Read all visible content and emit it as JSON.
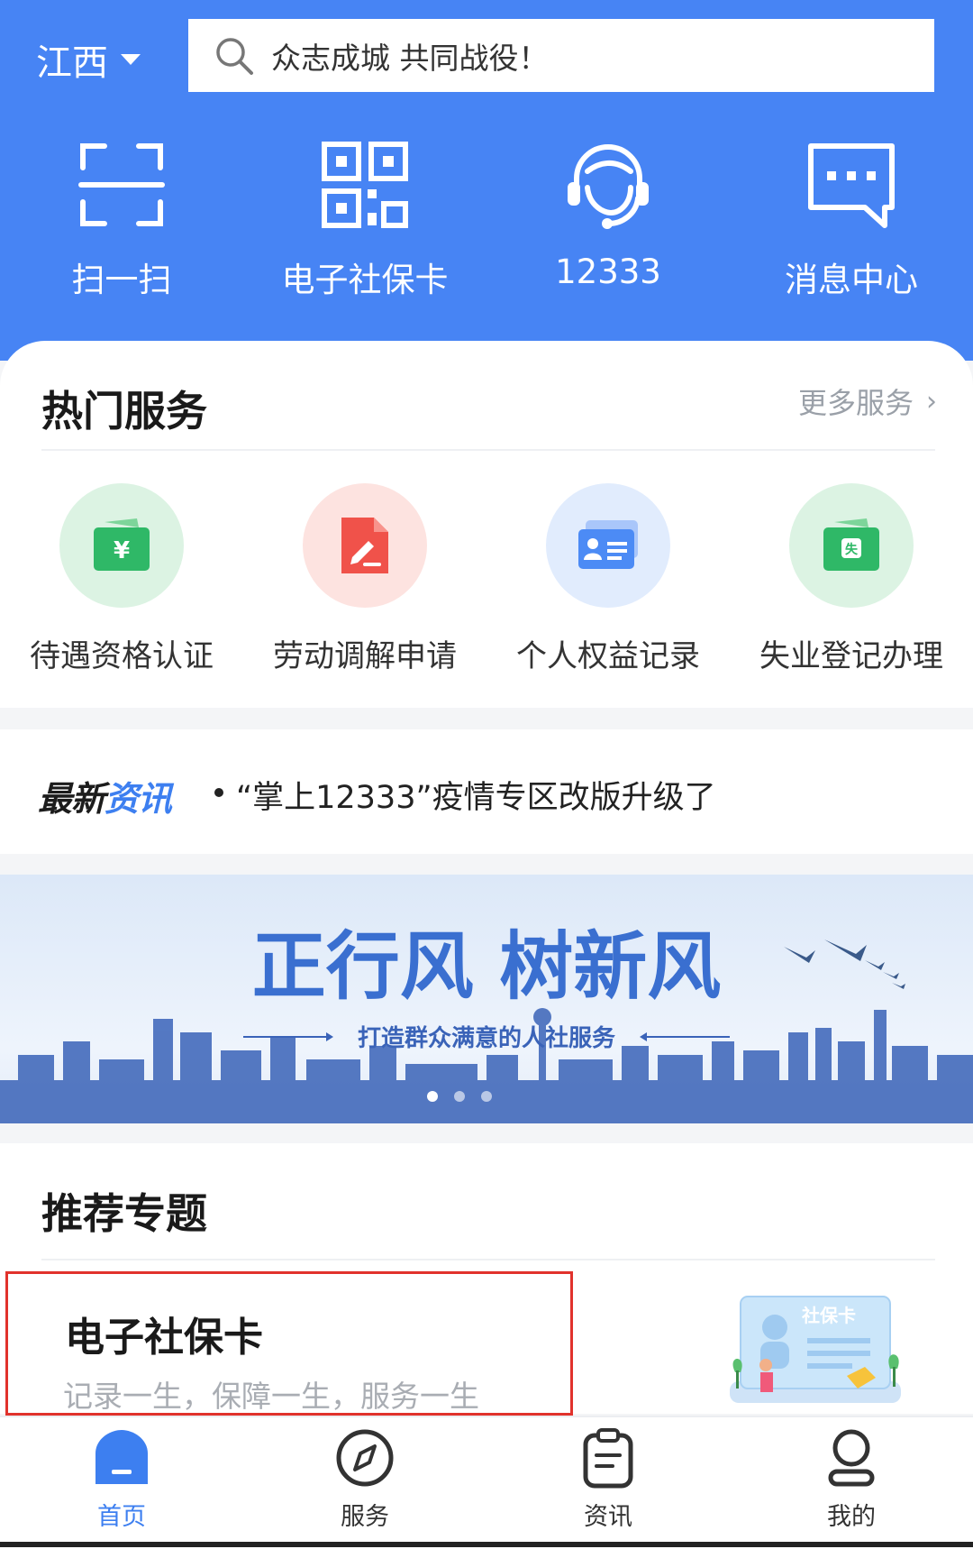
{
  "header": {
    "region": "江西",
    "search_text": "众志成城  共同战役！",
    "quick_actions": [
      {
        "label": "扫一扫",
        "icon": "scan-icon"
      },
      {
        "label": "电子社保卡",
        "icon": "qr-code-icon"
      },
      {
        "label": "12333",
        "icon": "headset-icon"
      },
      {
        "label": "消息中心",
        "icon": "message-icon"
      }
    ]
  },
  "hot_services": {
    "title": "热门服务",
    "more": "更多服务",
    "items": [
      {
        "label": "待遇资格认证",
        "icon": "wallet-yuan-icon"
      },
      {
        "label": "劳动调解申请",
        "icon": "document-pen-icon"
      },
      {
        "label": "个人权益记录",
        "icon": "id-card-icon"
      },
      {
        "label": "失业登记办理",
        "icon": "unemployment-wallet-icon"
      }
    ]
  },
  "news": {
    "logo_part1": "最新",
    "logo_part2": "资讯",
    "headline": "“掌上12333”疫情专区改版升级了"
  },
  "banner": {
    "title": "正行风  树新风",
    "subtitle": "打造群众满意的人社服务",
    "page_count": 3,
    "active_page": 1
  },
  "recommend": {
    "title": "推荐专题",
    "card_title": "电子社保卡",
    "card_subtitle": "记录一生，保障一生，服务一生",
    "card_image_text": "社保卡"
  },
  "tabs": [
    {
      "label": "首页",
      "icon": "home-icon",
      "active": true
    },
    {
      "label": "服务",
      "icon": "compass-icon",
      "active": false
    },
    {
      "label": "资讯",
      "icon": "news-clipboard-icon",
      "active": false
    },
    {
      "label": "我的",
      "icon": "person-icon",
      "active": false
    }
  ],
  "colors": {
    "primary": "#4784f4",
    "active_tab": "#3d7ff0",
    "highlight_border": "#e1322c"
  }
}
